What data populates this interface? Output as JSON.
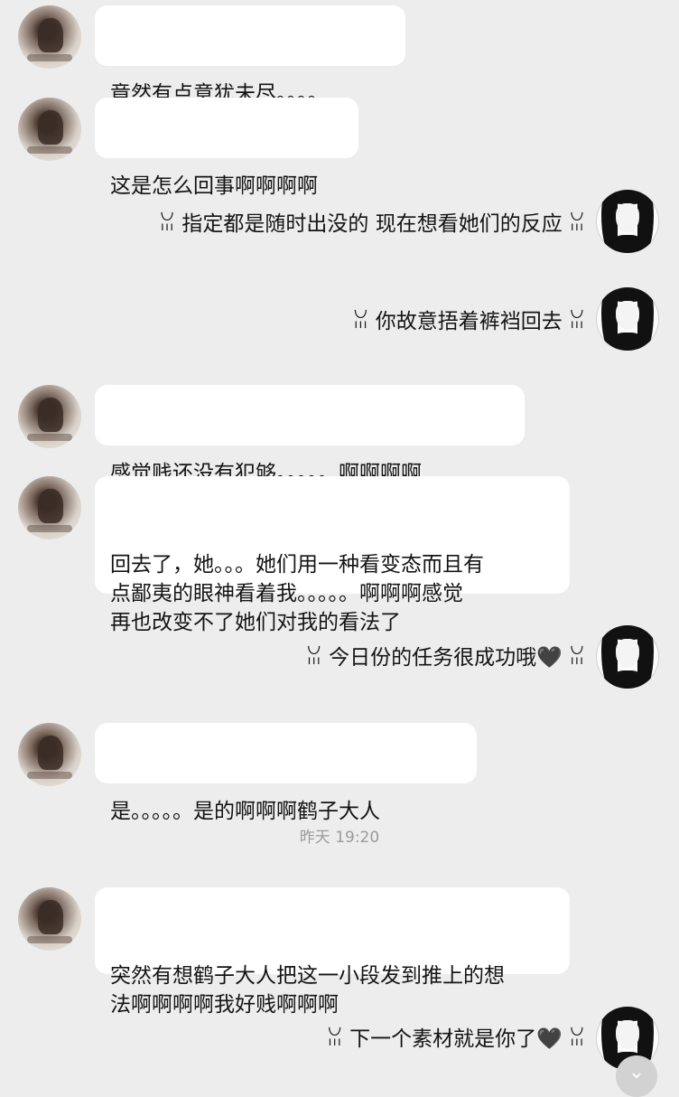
{
  "timestamp": "昨天 19:20",
  "messages": [
    {
      "side": "left",
      "text": "竟然有点意犹未尽。。。。"
    },
    {
      "side": "left",
      "text": "这是怎么回事啊啊啊啊"
    },
    {
      "side": "right",
      "text": "ꈍ 指定都是随时出没的 现在想看她们的反应 ꈍ"
    },
    {
      "side": "right",
      "text": "ꈍ 你故意捂着裤裆回去 ꈍ"
    },
    {
      "side": "left",
      "text": "感觉贱还没有犯够。。。。。啊啊啊啊"
    },
    {
      "side": "left",
      "text": "回去了，她。。。她们用一种看变态而且有\n点鄙夷的眼神看着我。。。。。啊啊啊感觉\n再也改变不了她们对我的看法了"
    },
    {
      "side": "right",
      "text": "ꈍ 今日份的任务很成功哦🖤 ꈍ"
    },
    {
      "side": "left",
      "text": "是。。。。。是的啊啊啊鹤子大人"
    },
    {
      "side": "left",
      "text": "突然有想鹤子大人把这一小段发到推上的想\n法啊啊啊啊我好贱啊啊啊"
    },
    {
      "side": "right",
      "text": "ꈍ 下一个素材就是你了🖤 ꈍ"
    }
  ],
  "icons": {
    "left_avatar": "user-avatar-photo",
    "right_avatar": "anime-girl-avatar",
    "scroll_down": "chevron-down-icon"
  }
}
